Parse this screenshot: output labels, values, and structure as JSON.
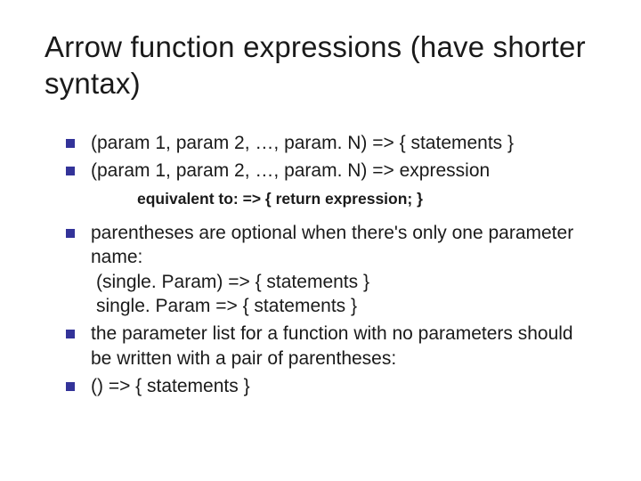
{
  "title": "Arrow function expressions (have shorter syntax)",
  "bullets": {
    "b1": "(param 1, param 2, …, param. N) => { statements }",
    "b2": "(param 1, param 2, …, param. N) => expression",
    "sub": "equivalent to: => { return expression; }",
    "b3_l1": "parentheses are optional when there's only one parameter name:",
    "b3_l2": "(single. Param) => { statements }",
    "b3_l3": "single. Param => { statements }",
    "b4": "the parameter list for a function with no parameters should be written with a pair of parentheses:",
    "b5": " () => { statements }"
  }
}
